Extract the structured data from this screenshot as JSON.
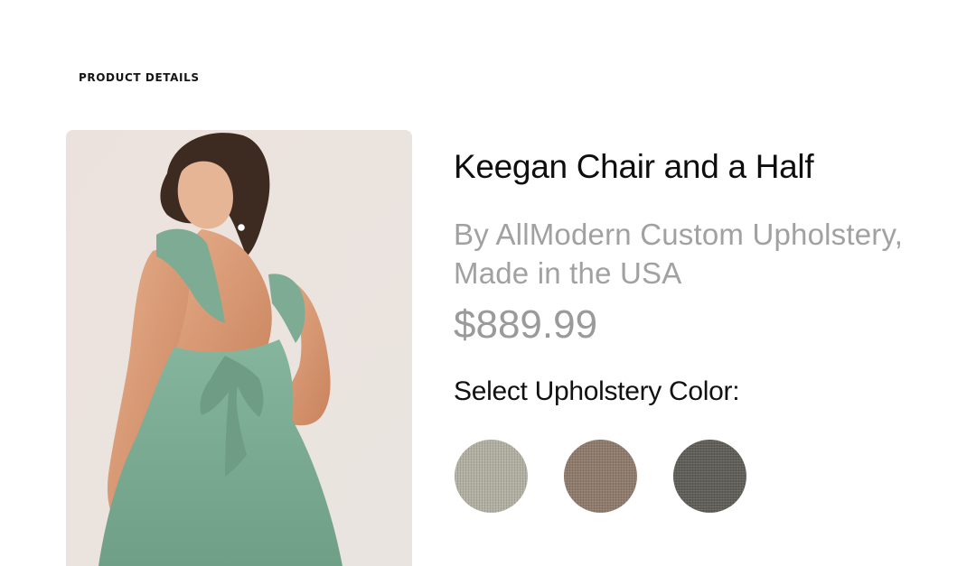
{
  "page": {
    "section_label": "PRODUCT DETAILS"
  },
  "product": {
    "image_alt": "Woman in green ruffle tie-back dress",
    "title": "Keegan Chair and a Half",
    "byline": "By AllModern Custom Upholstery, Made in the USA",
    "price": "$889.99"
  },
  "color_selector": {
    "label": "Select Upholstery Color:",
    "swatches": [
      {
        "name": "light-gray-linen",
        "color": "#b2b0a2"
      },
      {
        "name": "taupe-linen",
        "color": "#8f7b6b"
      },
      {
        "name": "charcoal-linen",
        "color": "#5f5e58"
      }
    ]
  }
}
